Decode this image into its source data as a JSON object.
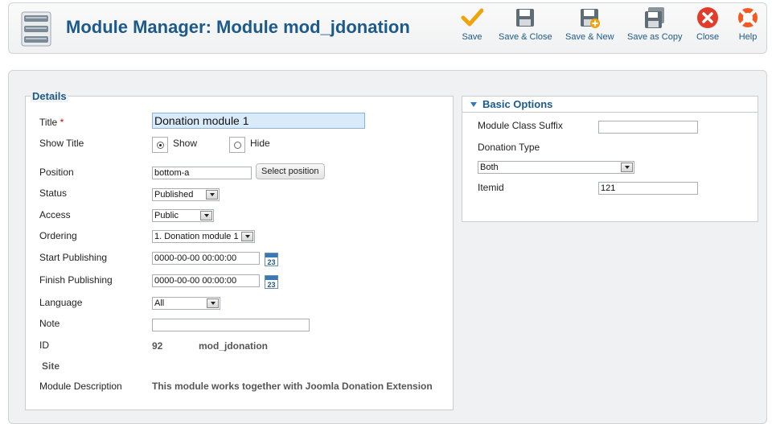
{
  "header": {
    "title": "Module Manager: Module mod_jdonation"
  },
  "toolbar": {
    "save": "Save",
    "save_close": "Save & Close",
    "save_new": "Save & New",
    "save_copy": "Save as Copy",
    "close": "Close",
    "help": "Help"
  },
  "details": {
    "legend": "Details",
    "title_label": "Title",
    "title_required": "*",
    "title_value": "Donation module 1",
    "show_title_label": "Show Title",
    "show_label": "Show",
    "hide_label": "Hide",
    "show_title_selected": "Show",
    "position_label": "Position",
    "position_value": "bottom-a",
    "select_position": "Select position",
    "status_label": "Status",
    "status_value": "Published",
    "access_label": "Access",
    "access_value": "Public",
    "ordering_label": "Ordering",
    "ordering_value": "1. Donation module 1",
    "start_label": "Start Publishing",
    "start_value": "0000-00-00 00:00:00",
    "finish_label": "Finish Publishing",
    "finish_value": "0000-00-00 00:00:00",
    "calendar_day": "23",
    "language_label": "Language",
    "language_value": "All",
    "note_label": "Note",
    "note_value": "",
    "id_label": "ID",
    "id_value": "92",
    "module_name": "mod_jdonation",
    "site_label": "Site",
    "description_label": "Module Description",
    "description_value": "This module works together with Joomla Donation Extension"
  },
  "basic_options": {
    "title": "Basic Options",
    "class_suffix_label": "Module Class Suffix",
    "class_suffix_value": "",
    "donation_type_label": "Donation Type",
    "donation_type_value": "Both",
    "itemid_label": "Itemid",
    "itemid_value": "121"
  },
  "colors": {
    "title_blue": "#1c5a8a",
    "save_check": "#f0a30a",
    "close_red": "#e23c2a",
    "input_focus": "#d9eafa"
  },
  "icons": {
    "module": "module-manager-icon",
    "save": "checkmark-icon",
    "save_close": "floppy-disk-icon",
    "save_new": "floppy-disk-plus-icon",
    "save_copy": "floppy-disk-copy-icon",
    "close": "close-icon",
    "help": "lifebuoy-icon",
    "calendar": "calendar-icon"
  }
}
